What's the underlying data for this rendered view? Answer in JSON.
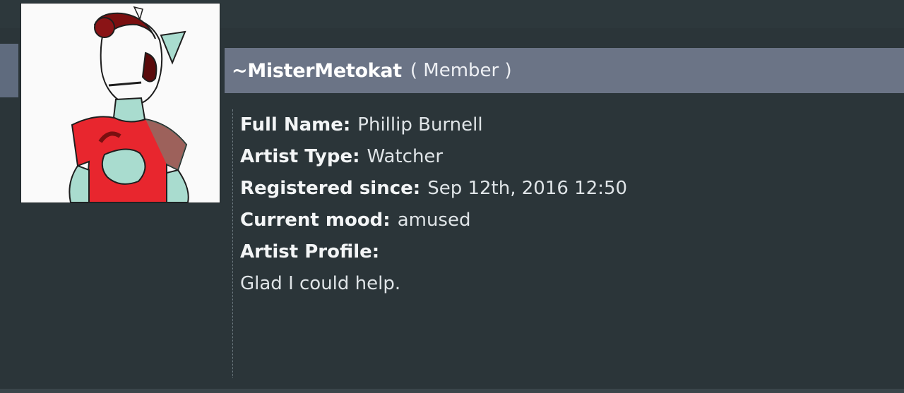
{
  "profile": {
    "username": "~MisterMetokat",
    "role": "( Member )",
    "fields": {
      "full_name_label": "Full Name:",
      "full_name_value": "Phillip Burnell",
      "artist_type_label": "Artist Type:",
      "artist_type_value": "Watcher",
      "registered_label": "Registered since:",
      "registered_value": "Sep 12th, 2016 12:50",
      "mood_label": "Current mood:",
      "mood_value": "amused",
      "artist_profile_label": "Artist Profile:",
      "artist_profile_text": "Glad I could help."
    }
  },
  "avatar": {
    "icon": "avatar-illustration",
    "colors": {
      "background": "#fafafa",
      "shirt": "#e8262e",
      "skin": "#a9dccf",
      "hair": "#7a0f10",
      "outline": "#1e1e1e"
    }
  },
  "colors": {
    "background": "#2b3539",
    "username_bar": "#6b7486"
  }
}
